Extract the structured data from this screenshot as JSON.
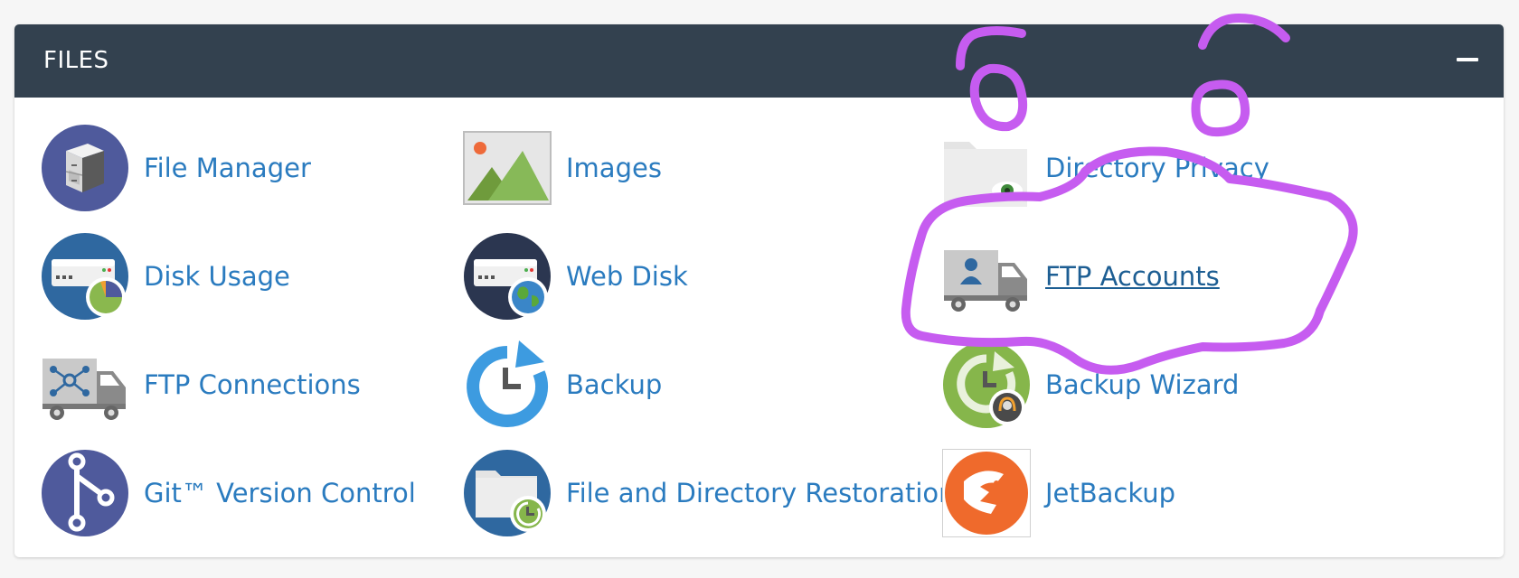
{
  "section": {
    "title": "FILES",
    "collapse_icon": "minus-icon"
  },
  "items": [
    {
      "label": "File Manager",
      "icon": "file-manager-icon"
    },
    {
      "label": "Images",
      "icon": "images-icon"
    },
    {
      "label": "Directory Privacy",
      "icon": "directory-privacy-icon"
    },
    {
      "label": "Disk Usage",
      "icon": "disk-usage-icon"
    },
    {
      "label": "Web Disk",
      "icon": "web-disk-icon"
    },
    {
      "label": "FTP Accounts",
      "icon": "ftp-accounts-icon"
    },
    {
      "label": "FTP Connections",
      "icon": "ftp-connections-icon"
    },
    {
      "label": "Backup",
      "icon": "backup-icon"
    },
    {
      "label": "Backup Wizard",
      "icon": "backup-wizard-icon"
    },
    {
      "label": "Git™ Version Control",
      "icon": "git-version-control-icon"
    },
    {
      "label": "File and Directory Restoration",
      "icon": "file-directory-restoration-icon"
    },
    {
      "label": "JetBackup",
      "icon": "jetbackup-icon"
    }
  ],
  "annotation_color": "#c65cf0",
  "colors": {
    "header_bg": "#33414f",
    "link": "#2a7bbf",
    "link_hover": "#1d5e93"
  }
}
